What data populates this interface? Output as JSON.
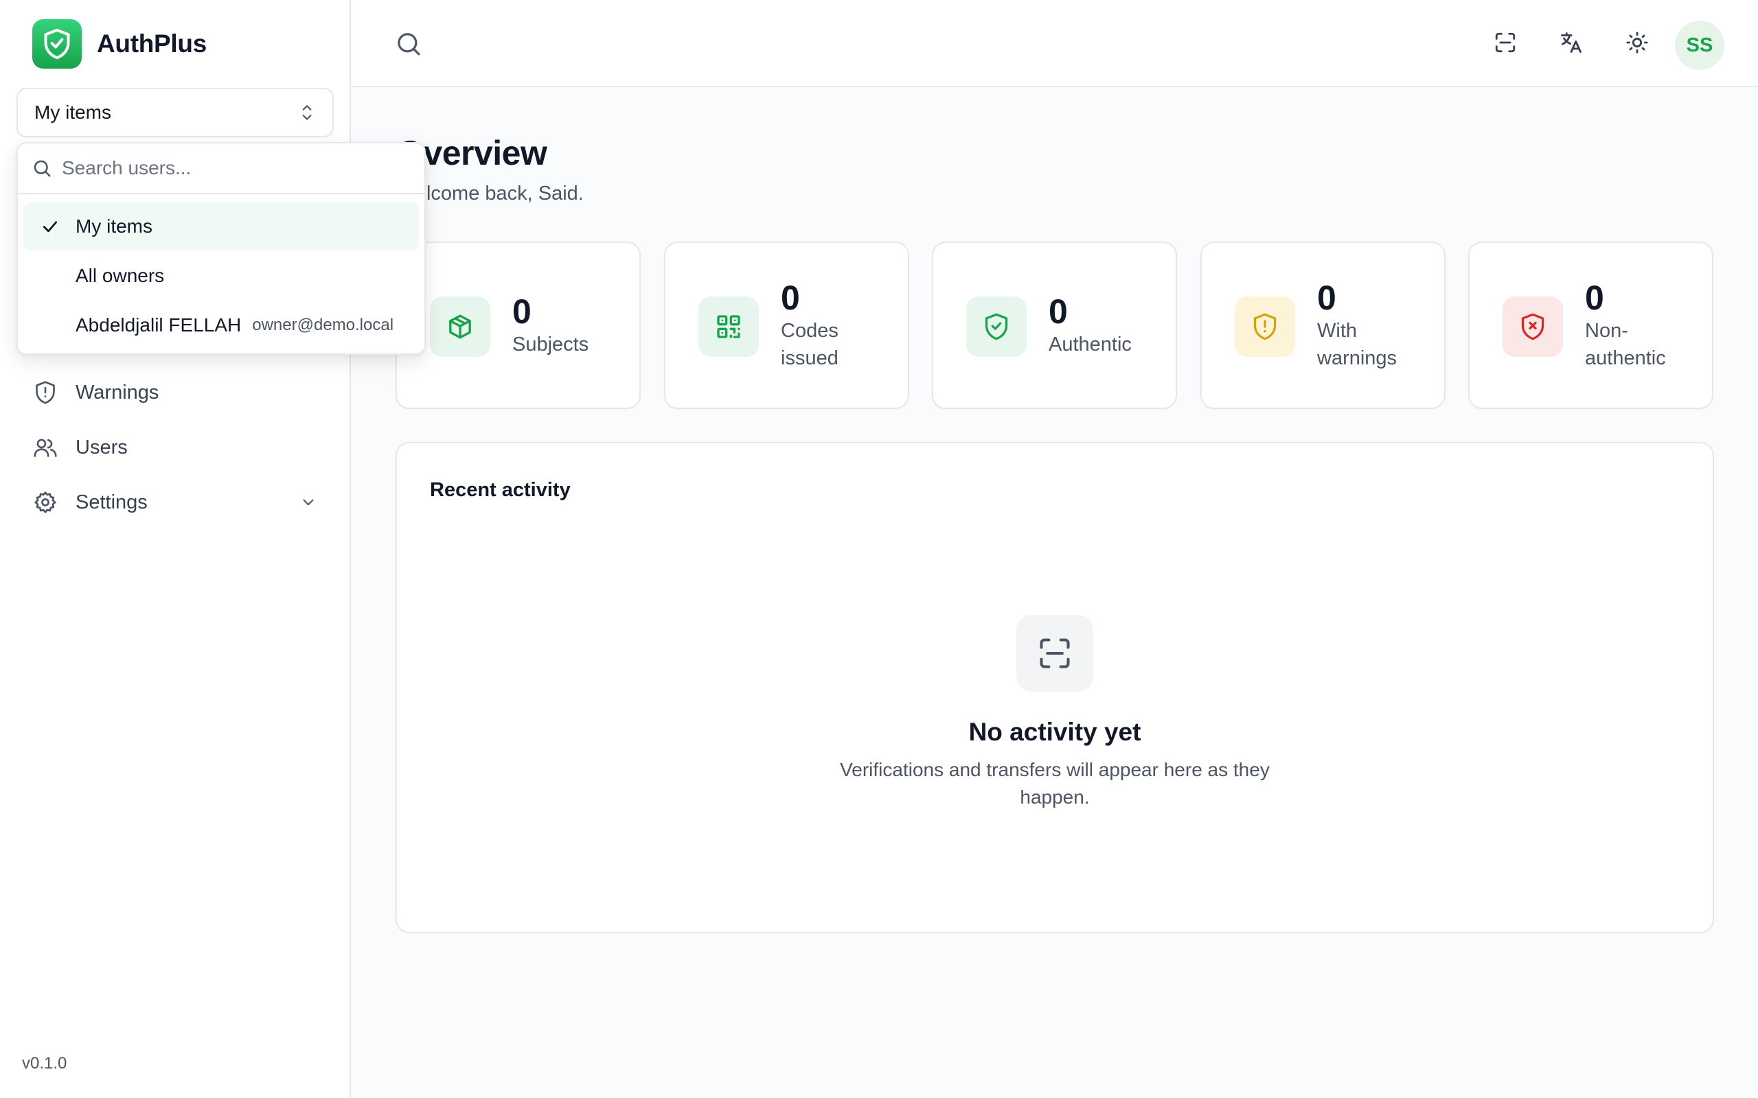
{
  "app": {
    "name": "AuthPlus",
    "version": "v0.1.0"
  },
  "owner_select": {
    "selected": "My items"
  },
  "dropdown": {
    "search_placeholder": "Search users...",
    "items": [
      {
        "name": "My items",
        "email": "",
        "selected": true
      },
      {
        "name": "All owners",
        "email": "",
        "selected": false
      },
      {
        "name": "Abdeldjalil FELLAH",
        "email": "owner@demo.local",
        "selected": false
      }
    ]
  },
  "nav": {
    "items": [
      {
        "label": "Warnings",
        "icon": "shield-alert-icon"
      },
      {
        "label": "Users",
        "icon": "users-icon"
      },
      {
        "label": "Settings",
        "icon": "gear-icon"
      }
    ]
  },
  "topbar": {
    "icons": [
      "search-icon",
      "scan-icon",
      "translate-icon",
      "sun-icon"
    ],
    "avatar_initials": "SS"
  },
  "page": {
    "title": "Overview",
    "subtitle": "Welcome back, Said."
  },
  "stats": [
    {
      "value": "0",
      "label": "Subjects",
      "icon": "package-icon",
      "color": "#16a34a",
      "bg": "#e6f6ec"
    },
    {
      "value": "0",
      "label": "Codes issued",
      "icon": "qr-code-icon",
      "color": "#16a34a",
      "bg": "#e6f6ec"
    },
    {
      "value": "0",
      "label": "Authentic",
      "icon": "shield-check-icon",
      "color": "#16a34a",
      "bg": "#e6f6ec"
    },
    {
      "value": "0",
      "label": "With warnings",
      "icon": "shield-alert-icon",
      "color": "#d4a106",
      "bg": "#fdf3d6"
    },
    {
      "value": "0",
      "label": "Non-authentic",
      "icon": "shield-x-icon",
      "color": "#dc2626",
      "bg": "#fce7e7"
    }
  ],
  "activity": {
    "title": "Recent activity",
    "empty_title": "No activity yet",
    "empty_desc": "Verifications and transfers will appear here as they happen."
  },
  "colors": {
    "accent": "#16a34a",
    "border": "#e5e7eb",
    "text": "#111827",
    "muted": "#4b5563"
  }
}
